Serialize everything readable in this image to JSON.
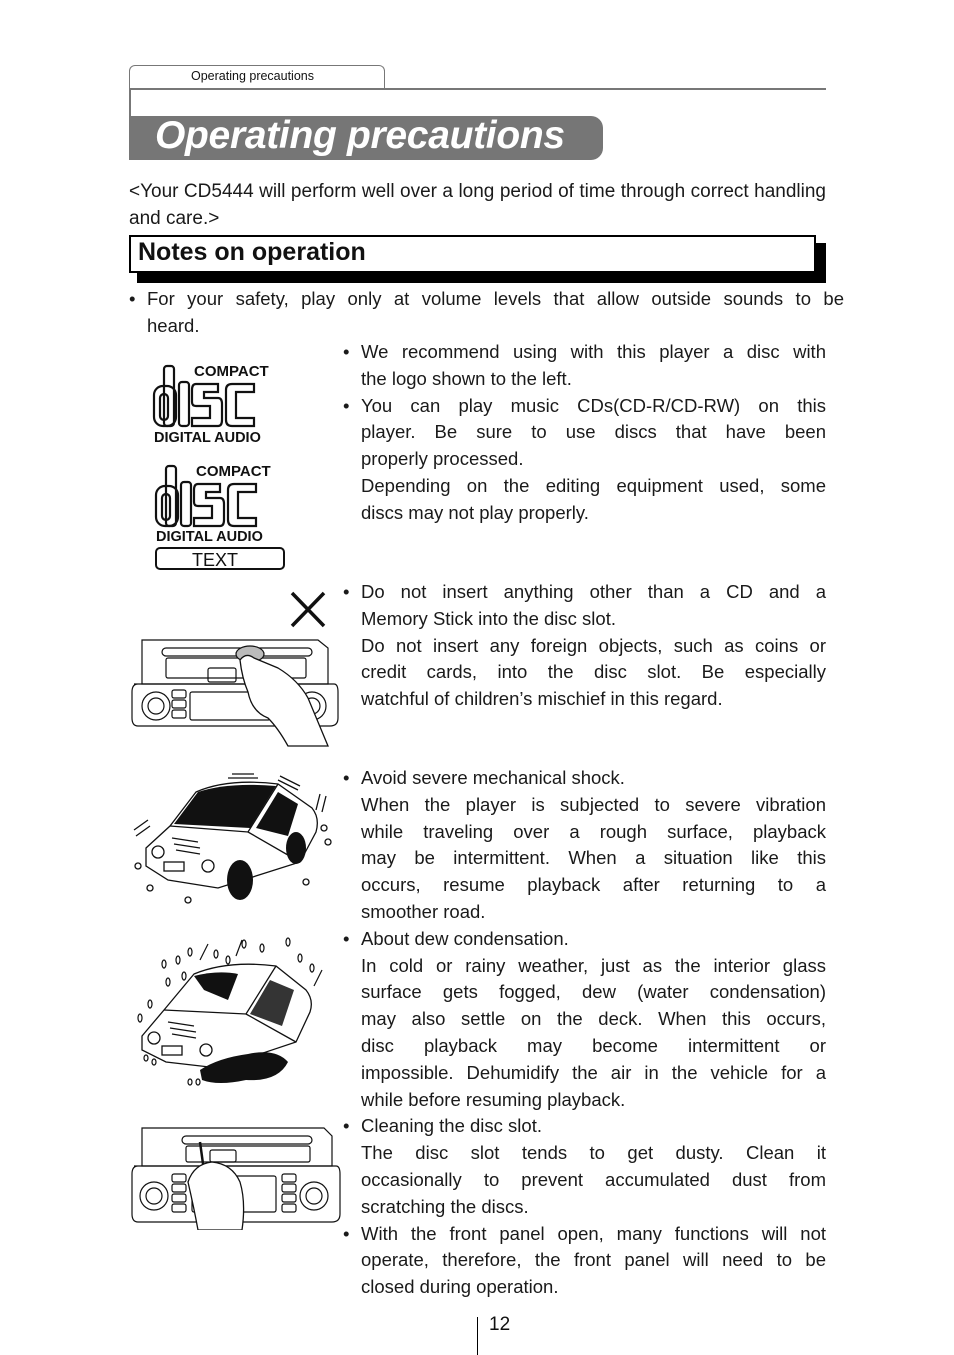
{
  "header": {
    "tab_label": "Operating precautions",
    "title": "Operating precautions"
  },
  "intro": "<Your CD5444 will perform well over a long period of time through correct handling and care.>",
  "section": {
    "title": "Notes on operation"
  },
  "safety_bullet": {
    "lines": [
      "For your safety, play only at volume levels that allow outside sounds to be",
      "heard."
    ]
  },
  "logos": {
    "cd_da": {
      "top": "COMPACT",
      "main": "disc",
      "bottom": "DIGITAL AUDIO"
    },
    "cd_text": {
      "top": "COMPACT",
      "main": "disc",
      "bottom": "DIGITAL AUDIO",
      "badge": "TEXT"
    }
  },
  "bullets": [
    {
      "lines": [
        "We recommend using with this player a disc with",
        "the logo shown to the left."
      ]
    },
    {
      "lines": [
        "You can play music CDs(CD-R/CD-RW) on this",
        "player. Be sure to use discs that have been",
        "properly processed.",
        "Depending on the editing equipment used, some",
        "discs may not play properly."
      ]
    },
    {
      "lines": [
        "Do not insert anything other than a CD and a",
        "Memory Stick into the disc slot.",
        "Do not insert any foreign objects, such as coins or",
        "credit cards, into the disc slot. Be especially",
        "watchful of children’s mischief in this regard."
      ]
    },
    {
      "lines": [
        "Avoid severe mechanical shock.",
        "When the player is subjected to severe vibration",
        "while traveling over a rough surface, playback",
        "may be intermittent. When a situation like this",
        "occurs, resume playback after returning to a",
        "smoother road."
      ]
    },
    {
      "lines": [
        "About dew condensation.",
        "In cold or rainy weather, just as the interior glass",
        "surface gets fogged, dew (water condensation)",
        "may also settle on the deck. When this occurs,",
        "disc playback may become intermittent or",
        "impossible. Dehumidify the air in the vehicle for a",
        "while before resuming playback."
      ]
    },
    {
      "lines": [
        "Cleaning the disc slot.",
        "The disc slot tends to get dusty. Clean it",
        "occasionally to prevent accumulated dust from",
        "scratching the discs."
      ]
    },
    {
      "lines": [
        "With the front panel open, many functions will not",
        "operate, therefore, the front panel will need to be",
        "closed during operation."
      ]
    }
  ],
  "illustrations": {
    "prohibited_mark": "x-mark-icon"
  },
  "footer": {
    "page_number": "12"
  }
}
